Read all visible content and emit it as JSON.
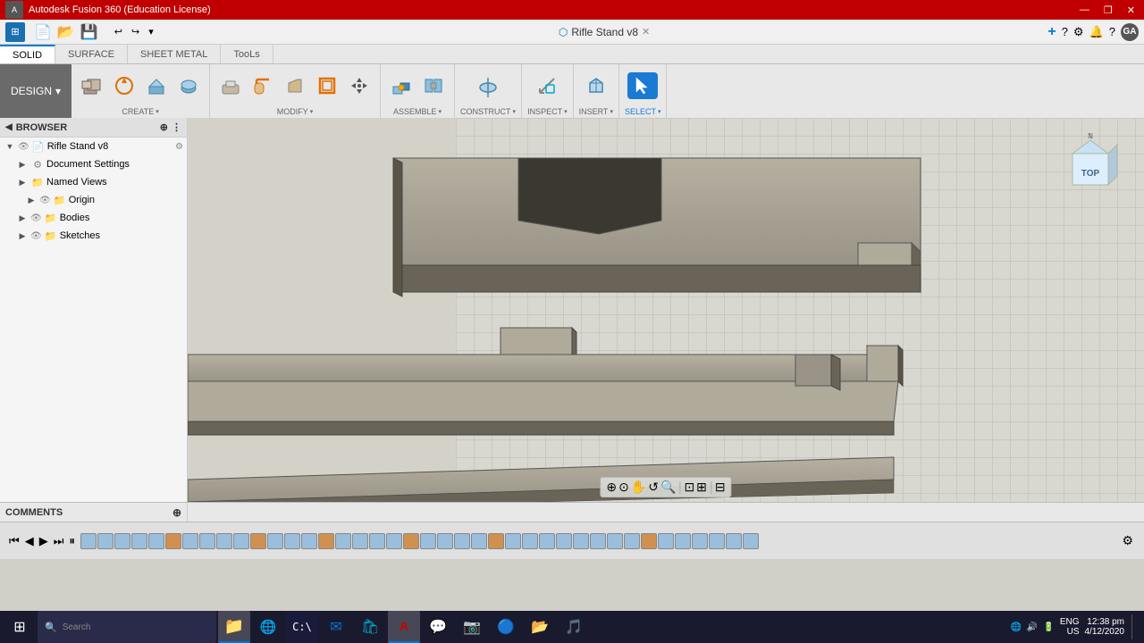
{
  "titlebar": {
    "title": "Autodesk Fusion 360 (Education License)",
    "controls": [
      "—",
      "❐",
      "✕"
    ]
  },
  "menubar": {
    "document_title": "Rifle Stand v8",
    "close_btn": "✕",
    "nav_btns": [
      "+",
      "?",
      "⚙",
      "?"
    ],
    "user": "GA"
  },
  "toolbar_tabs": [
    {
      "id": "solid",
      "label": "SOLID",
      "active": true
    },
    {
      "id": "surface",
      "label": "SURFACE",
      "active": false
    },
    {
      "id": "sheet_metal",
      "label": "SHEET METAL",
      "active": false
    },
    {
      "id": "tools",
      "label": "TooLs",
      "active": false
    }
  ],
  "toolbar_groups": [
    {
      "id": "create",
      "label": "CREATE",
      "has_arrow": true,
      "buttons": [
        {
          "id": "extrude",
          "icon": "🧊",
          "label": ""
        },
        {
          "id": "revolve",
          "icon": "⬡",
          "label": ""
        }
      ]
    },
    {
      "id": "modify",
      "label": "MODIFY",
      "has_arrow": true,
      "buttons": [
        {
          "id": "fillet",
          "icon": "◱",
          "label": ""
        },
        {
          "id": "chamfer",
          "icon": "▱",
          "label": ""
        },
        {
          "id": "shell",
          "icon": "🔲",
          "label": ""
        },
        {
          "id": "move",
          "icon": "✛",
          "label": ""
        }
      ]
    },
    {
      "id": "assemble",
      "label": "ASSEMBLE",
      "has_arrow": true,
      "buttons": [
        {
          "id": "joint",
          "icon": "⬡",
          "label": ""
        },
        {
          "id": "rigid",
          "icon": "⬡",
          "label": ""
        }
      ]
    },
    {
      "id": "construct",
      "label": "CONSTRUCT",
      "has_arrow": true,
      "buttons": [
        {
          "id": "plane",
          "icon": "⬡",
          "label": ""
        }
      ]
    },
    {
      "id": "inspect",
      "label": "INSPECT",
      "has_arrow": true,
      "buttons": [
        {
          "id": "measure",
          "icon": "📐",
          "label": ""
        }
      ]
    },
    {
      "id": "insert",
      "label": "INSERT",
      "has_arrow": true,
      "buttons": [
        {
          "id": "insert_mesh",
          "icon": "⬡",
          "label": ""
        }
      ]
    },
    {
      "id": "select",
      "label": "SELECT",
      "has_arrow": true,
      "active": true,
      "buttons": [
        {
          "id": "select_tool",
          "icon": "↖",
          "label": ""
        }
      ]
    }
  ],
  "design_btn": {
    "label": "DESIGN",
    "arrow": "▾"
  },
  "sidebar": {
    "header": "BROWSER",
    "items": [
      {
        "id": "root",
        "label": "Rifle Stand v8",
        "indent": 0,
        "arrow": "▼",
        "has_eye": true,
        "has_settings": true,
        "type": "file"
      },
      {
        "id": "doc_settings",
        "label": "Document Settings",
        "indent": 1,
        "arrow": "▶",
        "type": "settings"
      },
      {
        "id": "named_views",
        "label": "Named Views",
        "indent": 1,
        "arrow": "▶",
        "type": "folder"
      },
      {
        "id": "origin",
        "label": "Origin",
        "indent": 2,
        "arrow": "▶",
        "has_eye": true,
        "type": "folder"
      },
      {
        "id": "bodies",
        "label": "Bodies",
        "indent": 1,
        "arrow": "▶",
        "has_eye": true,
        "type": "folder"
      },
      {
        "id": "sketches",
        "label": "Sketches",
        "indent": 1,
        "arrow": "▶",
        "has_eye": true,
        "type": "folder"
      }
    ]
  },
  "comments": {
    "label": "COMMENTS"
  },
  "viewport": {
    "background": "#d0cfc8"
  },
  "bottom_toolbar": {
    "buttons": [
      "⊕",
      "⊙",
      "✋",
      "↺",
      "🔍",
      "⊡",
      "⊞",
      "⊟"
    ]
  },
  "timeline": {
    "items_count": 40,
    "controls": [
      "⏮",
      "◀",
      "▶",
      "⏭",
      "⏸"
    ]
  },
  "viewcube": {
    "label": "TOP"
  },
  "taskbar": {
    "start_icon": "⊞",
    "apps": [
      {
        "id": "explorer",
        "icon": "📁"
      },
      {
        "id": "edge",
        "icon": "🌐"
      },
      {
        "id": "cmd",
        "icon": "⬛"
      },
      {
        "id": "mail",
        "icon": "✉"
      },
      {
        "id": "fusion",
        "icon": "🅐"
      },
      {
        "id": "skype",
        "icon": "💬"
      },
      {
        "id": "store",
        "icon": "🛍"
      },
      {
        "id": "chrome",
        "icon": "🔵"
      },
      {
        "id": "files",
        "icon": "📂"
      },
      {
        "id": "spotify",
        "icon": "🎵"
      }
    ],
    "system": {
      "lang": "ENG",
      "region": "US",
      "time": "12:38 pm",
      "date": "4/12/2020"
    }
  }
}
